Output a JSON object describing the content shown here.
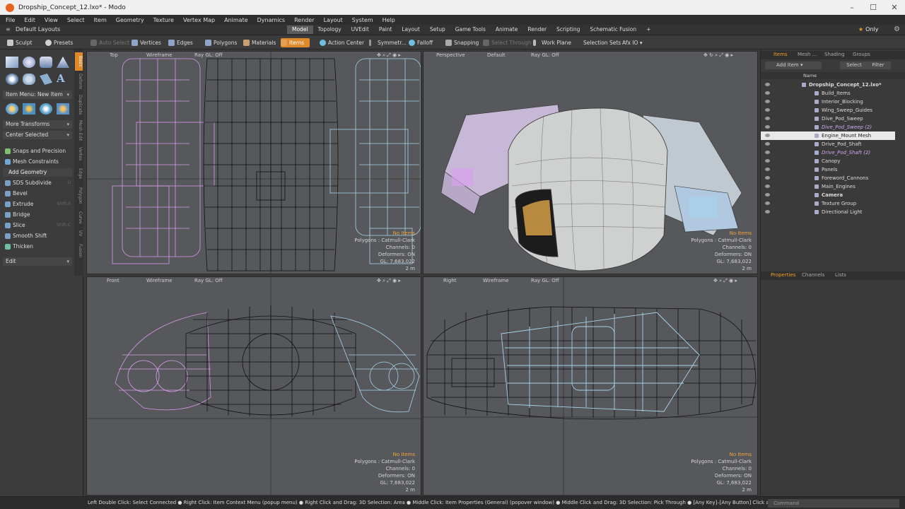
{
  "window": {
    "title": "Dropship_Concept_12.lxo* - Modo"
  },
  "menu": [
    "File",
    "Edit",
    "View",
    "Select",
    "Item",
    "Geometry",
    "Texture",
    "Vertex Map",
    "Animate",
    "Dynamics",
    "Render",
    "Layout",
    "System",
    "Help"
  ],
  "layout_bar": {
    "layouts": "Default Layouts",
    "tabs": [
      "Model",
      "Topology",
      "UVEdit",
      "Paint",
      "Layout",
      "Setup",
      "Game Tools",
      "Animate",
      "Render",
      "Scripting",
      "Schematic Fusion"
    ],
    "active_tab": "Model",
    "add_label": "+",
    "only_label": "Only"
  },
  "tool_row": {
    "sculpt": "Sculpt",
    "presets": "Presets",
    "auto_select": "Auto Select",
    "vertices": "Vertices",
    "edges": "Edges",
    "polygons": "Polygons",
    "materials": "Materials",
    "items": "Items",
    "action_center": "Action Center",
    "symmetry": "Symmetr...",
    "falloff": "Falloff",
    "snapping": "Snapping",
    "select_through": "Select Through",
    "work_plane": "Work Plane",
    "selection_sets": "Selection Sets",
    "afx": "Afx IO"
  },
  "left_toolbar": {
    "vertical_tabs": [
      "Basic",
      "Deform",
      "Duplicate",
      "Mesh Edit",
      "Vertex",
      "Edge",
      "Polygon",
      "Curve",
      "UV",
      "Fusion"
    ],
    "item_menu": "Item Menu: New Item",
    "more_transforms": "More Transforms",
    "center_selected": "Center Selected",
    "snaps": "Snaps and Precision",
    "mesh_constraints": "Mesh Constraints",
    "add_geometry": "Add Geometry",
    "sds_subdivide": "SDS Subdivide",
    "bevel": "Bevel",
    "extrude": "Extrude",
    "extrude_key": "Shift-X",
    "bridge": "Bridge",
    "slice": "Slice",
    "slice_key": "Shift-C",
    "smooth_shift": "Smooth Shift",
    "thicken": "Thicken",
    "edit": "Edit"
  },
  "viewports": {
    "top": {
      "view": "Top",
      "shading": "Wireframe",
      "raygl": "Ray GL: Off",
      "info": [
        "No Items",
        "Polygons : Catmull-Clark",
        "Channels: 0",
        "Deformers: ON",
        "GL: 7,683,022",
        "2 m"
      ]
    },
    "perspective": {
      "view": "Perspective",
      "shading": "Default",
      "raygl": "Ray GL: Off",
      "info": [
        "No Items",
        "Polygons : Catmull-Clark",
        "Channels: 0",
        "Deformers: ON",
        "GL: 7,683,022",
        "2 m"
      ]
    },
    "front": {
      "view": "Front",
      "shading": "Wireframe",
      "raygl": "Ray GL: Off",
      "info": [
        "No Items",
        "Polygons : Catmull-Clark",
        "Channels: 0",
        "Deformers: ON",
        "GL: 7,683,022",
        "2 m"
      ]
    },
    "right": {
      "view": "Right",
      "shading": "Wireframe",
      "raygl": "Ray GL: Off",
      "info": [
        "No Items",
        "Polygons : Catmull-Clark",
        "Channels: 0",
        "Deformers: ON",
        "GL: 7,683,022",
        "2 m"
      ]
    }
  },
  "right_panel": {
    "tabs": [
      "Items",
      "Mesh ...",
      "Shading",
      "Groups"
    ],
    "add_item": "Add Item",
    "select": "Select",
    "filter": "Filter",
    "name_col": "Name",
    "items": [
      {
        "label": "Dropship_Concept_12.lxo*",
        "style": "bold",
        "indent": 0
      },
      {
        "label": "Build_Items",
        "style": "",
        "indent": 1
      },
      {
        "label": "Interior_Blocking",
        "style": "",
        "indent": 1
      },
      {
        "label": "Wing_Sweep_Guides",
        "style": "",
        "indent": 1
      },
      {
        "label": "Dive_Pod_Sweep",
        "style": "",
        "indent": 1
      },
      {
        "label": "Dive_Pod_Sweep (2)",
        "style": "ital",
        "indent": 1
      },
      {
        "label": "Engine_Mount Mesh",
        "style": "sel",
        "indent": 1
      },
      {
        "label": "Drive_Pod_Shaft",
        "style": "",
        "indent": 1
      },
      {
        "label": "Drive_Pod_Shaft (2)",
        "style": "ital",
        "indent": 1
      },
      {
        "label": "Canopy",
        "style": "",
        "indent": 1
      },
      {
        "label": "Panels",
        "style": "",
        "indent": 1
      },
      {
        "label": "Foreword_Cannons",
        "style": "",
        "indent": 1
      },
      {
        "label": "Main_Engines",
        "style": "",
        "indent": 1
      },
      {
        "label": "Camera",
        "style": "bold",
        "indent": 1
      },
      {
        "label": "Texture Group",
        "style": "",
        "indent": 1
      },
      {
        "label": "Directional Light",
        "style": "",
        "indent": 1
      }
    ],
    "bottom_tabs": [
      "Properties",
      "Channels",
      "Lists"
    ]
  },
  "status_bar": {
    "text": "Left Double Click: Select Connected ● Right Click: Item Context Menu (popup menu) ● Right Click and Drag: 3D Selection: Area ● Middle Click: Item Properties (General) (popover window) ● Middle Click and Drag: 3D Selection: Pick Through ● [Any Key]–[Any Button] Click and Drag: dragDro...",
    "command_placeholder": "Command"
  },
  "colors": {
    "accent": "#e0892a",
    "viewport_bg": "#56585c",
    "wire_pink": "#d79ae8",
    "wire_blue": "#a8d2ea",
    "wire_black": "#111111"
  }
}
